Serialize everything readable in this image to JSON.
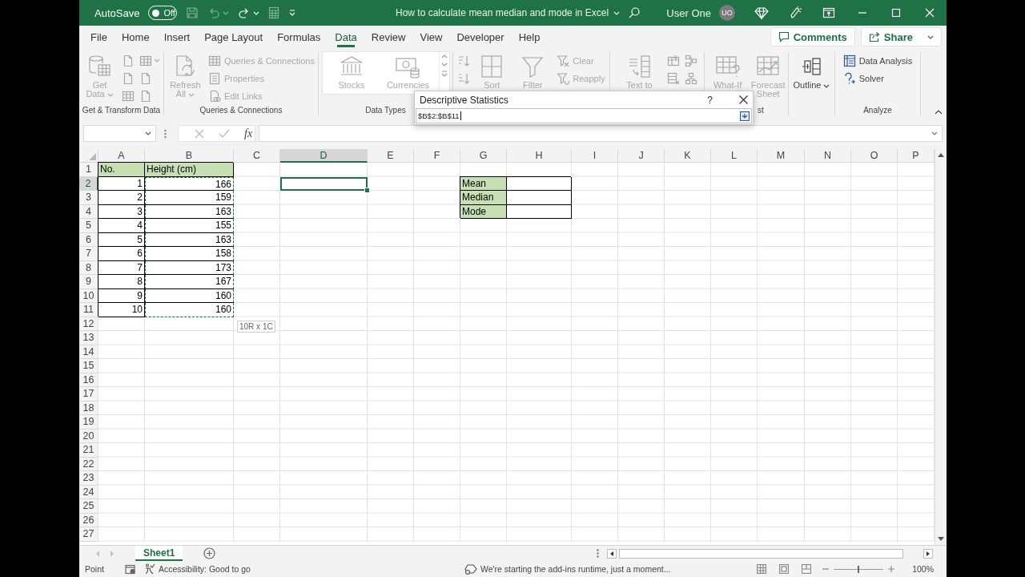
{
  "title_bar": {
    "autosave_label": "AutoSave",
    "autosave": {
      "on": false,
      "label": "Off"
    },
    "document_title": "How to calculate mean median and mode in Excel",
    "user_name": "User One",
    "avatar_initials": "UO"
  },
  "menu_tabs": [
    {
      "label": "File",
      "selected": false
    },
    {
      "label": "Home",
      "selected": false
    },
    {
      "label": "Insert",
      "selected": false
    },
    {
      "label": "Page Layout",
      "selected": false
    },
    {
      "label": "Formulas",
      "selected": false
    },
    {
      "label": "Data",
      "selected": true
    },
    {
      "label": "Review",
      "selected": false
    },
    {
      "label": "View",
      "selected": false
    },
    {
      "label": "Developer",
      "selected": false
    },
    {
      "label": "Help",
      "selected": false
    }
  ],
  "comments_button": "Comments",
  "share_button": "Share",
  "ribbon_groups": [
    {
      "kind": "plain",
      "label": "Get & Transform Data",
      "items": [
        {
          "kind": "large",
          "label": "Get Data",
          "disabled": true,
          "dropdown": true
        },
        {
          "kind": "icon",
          "disabled": true,
          "dropdown": false
        },
        {
          "kind": "icon",
          "disabled": true,
          "dropdown": false
        },
        {
          "kind": "icon",
          "disabled": true,
          "dropdown": false
        },
        {
          "kind": "icon",
          "disabled": true,
          "dropdown": true
        },
        {
          "kind": "icon",
          "disabled": true,
          "dropdown": false
        },
        {
          "kind": "icon",
          "disabled": true,
          "dropdown": false
        }
      ]
    },
    {
      "kind": "plain",
      "label": "Queries & Connections",
      "items": [
        {
          "kind": "large",
          "label": "Refresh All",
          "disabled": true,
          "dropdown": true
        },
        {
          "kind": "small",
          "label": "Queries & Connections",
          "disabled": true,
          "dropdown": false
        },
        {
          "kind": "small",
          "label": "Properties",
          "disabled": true,
          "dropdown": false
        },
        {
          "kind": "small",
          "label": "Edit Links",
          "disabled": true,
          "dropdown": false
        }
      ]
    },
    {
      "kind": "gallery",
      "label": "Data Types",
      "items": [
        {
          "kind": "large",
          "label": "Stocks",
          "disabled": true,
          "dropdown": false
        },
        {
          "kind": "large",
          "label": "Currencies",
          "disabled": true,
          "dropdown": false
        }
      ]
    },
    {
      "kind": "plain",
      "items": [
        {
          "kind": "icon",
          "disabled": true,
          "dropdown": false
        },
        {
          "kind": "icon",
          "disabled": true,
          "dropdown": false
        },
        {
          "kind": "large",
          "label": "Sort",
          "disabled": true,
          "dropdown": false
        },
        {
          "kind": "large",
          "label": "Filter",
          "disabled": true,
          "dropdown": false
        },
        {
          "kind": "small",
          "label": "Clear",
          "disabled": true,
          "dropdown": false
        },
        {
          "kind": "small",
          "label": "Reapply",
          "disabled": true,
          "dropdown": false
        }
      ]
    },
    {
      "kind": "plain",
      "items": [
        {
          "kind": "large",
          "label": "Text to",
          "disabled": true,
          "dropdown": false
        },
        {
          "kind": "icon",
          "disabled": true,
          "dropdown": false
        },
        {
          "kind": "icon",
          "disabled": true,
          "dropdown": false
        },
        {
          "kind": "icon",
          "disabled": true,
          "dropdown": false
        },
        {
          "kind": "icon",
          "disabled": true,
          "dropdown": false
        }
      ]
    },
    {
      "kind": "plain",
      "label": "st",
      "items": [
        {
          "kind": "large",
          "label": "What-If",
          "disabled": true,
          "dropdown": false
        },
        {
          "kind": "large",
          "label": "Forecast Sheet",
          "disabled": true,
          "dropdown": false
        }
      ]
    },
    {
      "kind": "plain",
      "items": [
        {
          "kind": "large",
          "label": "Outline",
          "disabled": false,
          "dropdown": true
        }
      ]
    },
    {
      "kind": "plain",
      "label": "Analyze",
      "items": [
        {
          "kind": "small",
          "label": "Data Analysis",
          "disabled": false,
          "dropdown": false
        },
        {
          "kind": "small",
          "label": "Solver",
          "disabled": false,
          "dropdown": false
        }
      ]
    }
  ],
  "dialog": {
    "title": "Descriptive Statistics",
    "help_button": "?",
    "range_value": "$B$2:$B$11"
  },
  "formula_bar": {
    "function_label": "fx"
  },
  "sheet": {
    "columns": [
      {
        "label": "A",
        "selected": false
      },
      {
        "label": "B",
        "selected": false
      },
      {
        "label": "C",
        "selected": false
      },
      {
        "label": "D",
        "selected": true
      },
      {
        "label": "E",
        "selected": false
      },
      {
        "label": "F",
        "selected": false
      },
      {
        "label": "G",
        "selected": false
      },
      {
        "label": "H",
        "selected": false
      },
      {
        "label": "I",
        "selected": false
      },
      {
        "label": "J",
        "selected": false
      },
      {
        "label": "K",
        "selected": false
      },
      {
        "label": "L",
        "selected": false
      },
      {
        "label": "M",
        "selected": false
      },
      {
        "label": "N",
        "selected": false
      },
      {
        "label": "O",
        "selected": false
      },
      {
        "label": "P",
        "selected": false
      }
    ],
    "rows": [
      {
        "label": "1",
        "selected": false,
        "cells": [
          {
            "kind": "text",
            "value": "No.",
            "filled": true,
            "bordered": true,
            "marked": false
          },
          {
            "kind": "text",
            "value": "Height (cm)",
            "filled": true,
            "bordered": true,
            "marked": false
          }
        ]
      },
      {
        "label": "2",
        "selected": true,
        "cells": [
          {
            "kind": "number",
            "value": "1",
            "filled": false,
            "bordered": true,
            "marked": false
          },
          {
            "kind": "number",
            "value": "166",
            "filled": false,
            "bordered": true,
            "marked": true
          }
        ],
        "summary_cells": [
          {
            "kind": "text",
            "value": "Mean",
            "filled": true,
            "bordered": true,
            "marked": false
          },
          {
            "kind": "empty",
            "filled": false,
            "bordered": true,
            "marked": false
          }
        ]
      },
      {
        "label": "3",
        "selected": false,
        "cells": [
          {
            "kind": "number",
            "value": "2",
            "filled": false,
            "bordered": true,
            "marked": false
          },
          {
            "kind": "number",
            "value": "159",
            "filled": false,
            "bordered": true,
            "marked": true
          }
        ],
        "summary_cells": [
          {
            "kind": "text",
            "value": "Median",
            "filled": true,
            "bordered": true,
            "marked": false
          },
          {
            "kind": "empty",
            "filled": false,
            "bordered": true,
            "marked": false
          }
        ]
      },
      {
        "label": "4",
        "selected": false,
        "cells": [
          {
            "kind": "number",
            "value": "3",
            "filled": false,
            "bordered": true,
            "marked": false
          },
          {
            "kind": "number",
            "value": "163",
            "filled": false,
            "bordered": true,
            "marked": true
          }
        ],
        "summary_cells": [
          {
            "kind": "text",
            "value": "Mode",
            "filled": true,
            "bordered": true,
            "marked": false
          },
          {
            "kind": "empty",
            "filled": false,
            "bordered": true,
            "marked": false
          }
        ]
      },
      {
        "label": "5",
        "selected": false,
        "cells": [
          {
            "kind": "number",
            "value": "4",
            "filled": false,
            "bordered": true,
            "marked": false
          },
          {
            "kind": "number",
            "value": "155",
            "filled": false,
            "bordered": true,
            "marked": true
          }
        ]
      },
      {
        "label": "6",
        "selected": false,
        "cells": [
          {
            "kind": "number",
            "value": "5",
            "filled": false,
            "bordered": true,
            "marked": false
          },
          {
            "kind": "number",
            "value": "163",
            "filled": false,
            "bordered": true,
            "marked": true
          }
        ]
      },
      {
        "label": "7",
        "selected": false,
        "cells": [
          {
            "kind": "number",
            "value": "6",
            "filled": false,
            "bordered": true,
            "marked": false
          },
          {
            "kind": "number",
            "value": "158",
            "filled": false,
            "bordered": true,
            "marked": true
          }
        ]
      },
      {
        "label": "8",
        "selected": false,
        "cells": [
          {
            "kind": "number",
            "value": "7",
            "filled": false,
            "bordered": true,
            "marked": false
          },
          {
            "kind": "number",
            "value": "173",
            "filled": false,
            "bordered": true,
            "marked": true
          }
        ]
      },
      {
        "label": "9",
        "selected": false,
        "cells": [
          {
            "kind": "number",
            "value": "8",
            "filled": false,
            "bordered": true,
            "marked": false
          },
          {
            "kind": "number",
            "value": "167",
            "filled": false,
            "bordered": true,
            "marked": true
          }
        ]
      },
      {
        "label": "10",
        "selected": false,
        "cells": [
          {
            "kind": "number",
            "value": "9",
            "filled": false,
            "bordered": true,
            "marked": false
          },
          {
            "kind": "number",
            "value": "160",
            "filled": false,
            "bordered": true,
            "marked": true
          }
        ]
      },
      {
        "label": "11",
        "selected": false,
        "cells": [
          {
            "kind": "number",
            "value": "10",
            "filled": false,
            "bordered": true,
            "marked": false
          },
          {
            "kind": "number",
            "value": "160",
            "filled": false,
            "bordered": true,
            "marked": true
          }
        ]
      },
      {
        "label": "12",
        "selected": false
      },
      {
        "label": "13",
        "selected": false
      },
      {
        "label": "14",
        "selected": false
      },
      {
        "label": "15",
        "selected": false
      },
      {
        "label": "16",
        "selected": false
      },
      {
        "label": "17",
        "selected": false
      },
      {
        "label": "18",
        "selected": false
      },
      {
        "label": "19",
        "selected": false
      },
      {
        "label": "20",
        "selected": false
      },
      {
        "label": "21",
        "selected": false
      },
      {
        "label": "22",
        "selected": false
      },
      {
        "label": "23",
        "selected": false
      },
      {
        "label": "24",
        "selected": false
      },
      {
        "label": "25",
        "selected": false
      },
      {
        "label": "26",
        "selected": false
      },
      {
        "label": "27",
        "selected": false
      }
    ],
    "selection_size": "10R x 1C"
  },
  "sheet_tabs": [
    {
      "label": "Sheet1",
      "selected": true
    }
  ],
  "status_bar": {
    "mode": "Point",
    "accessibility": "Accessibility: Good to go",
    "message": "We're starting the add-ins runtime, just a moment...",
    "zoom_slider": {
      "level": 0.5
    },
    "zoom": "100%"
  }
}
